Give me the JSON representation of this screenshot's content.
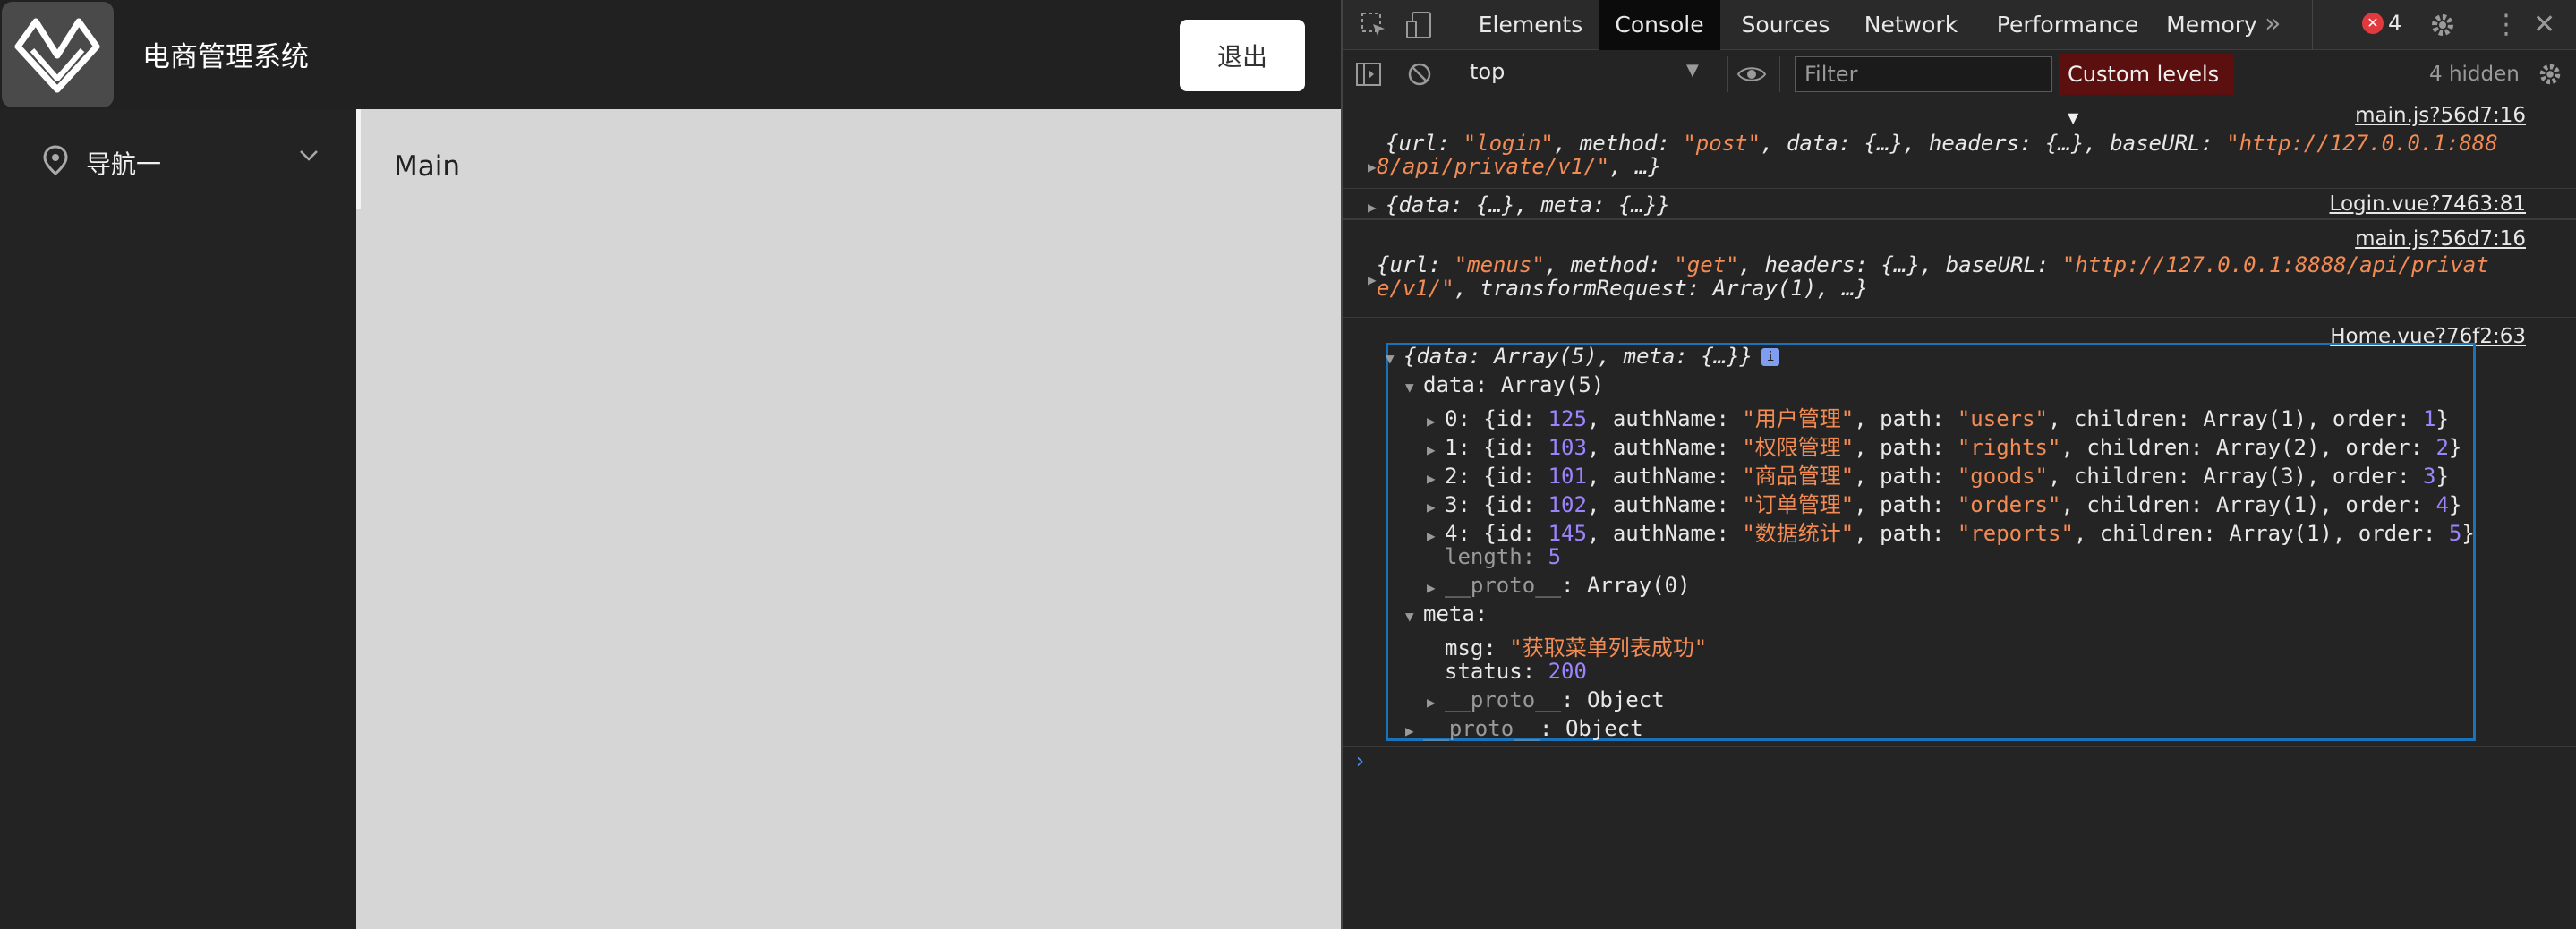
{
  "app": {
    "title": "电商管理系统",
    "logout_label": "退出",
    "nav_item_1": "导航一",
    "main_title": "Main"
  },
  "devtools": {
    "tabs": [
      "Elements",
      "Console",
      "Sources",
      "Network",
      "Performance",
      "Memory"
    ],
    "active_tab": "Console",
    "error_count": "4",
    "context": "top",
    "filter_placeholder": "Filter",
    "levels_label": "Custom levels",
    "hidden_label": "4 hidden",
    "entries": {
      "e1_src": "main.js?56d7:16",
      "e2_src": "Login.vue?7463:81",
      "e3_src": "main.js?56d7:16",
      "e4_src": "Home.vue?76f2:63"
    }
  },
  "colors": {
    "accent": "#1a73b8",
    "string": "#f28b54",
    "number": "#9c84ff",
    "error_badge": "#e0393e"
  },
  "icons": [
    "logo-icon",
    "location-pin-icon",
    "chevron-down-icon",
    "inspect-icon",
    "device-icon",
    "more-tabs-icon",
    "error-icon",
    "gear-icon",
    "kebab-icon",
    "close-icon",
    "sidebar-toggle-icon",
    "clear-console-icon",
    "eye-icon",
    "prompt-icon"
  ]
}
